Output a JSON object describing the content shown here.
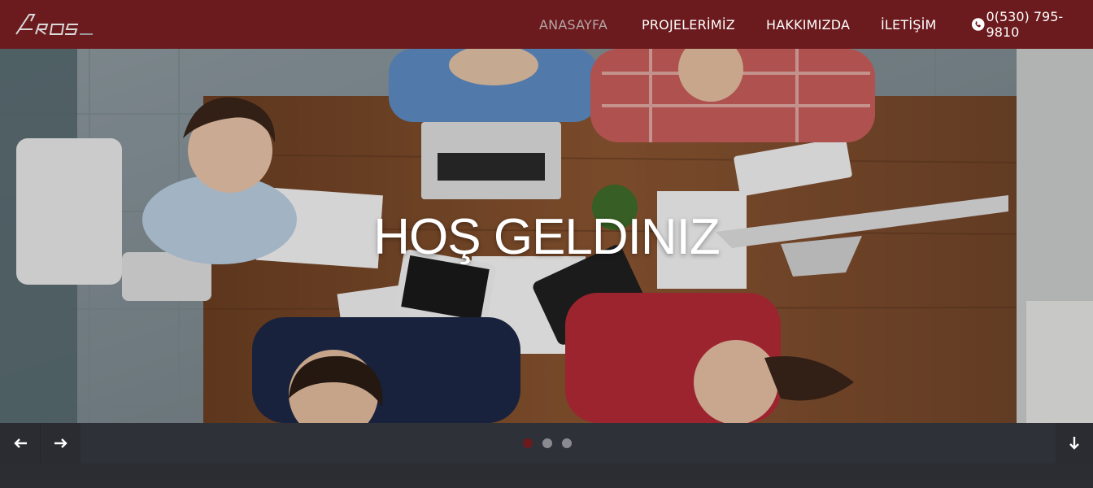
{
  "brand": {
    "logo_text": "Aros"
  },
  "nav": {
    "items": [
      {
        "label": "ANASAYFA",
        "active": true
      },
      {
        "label": "PROJELERİMİZ",
        "active": false
      },
      {
        "label": "HAKKIMIZDA",
        "active": false
      },
      {
        "label": "İLETİŞİM",
        "active": false
      }
    ],
    "phone": "0(530) 795-9810",
    "phone_icon": "phone-icon"
  },
  "hero": {
    "title": "HOŞ GELDINIZ",
    "image_description_icon": "team-meeting-photo"
  },
  "slider": {
    "prev_icon": "arrow-left-icon",
    "next_icon": "arrow-right-icon",
    "down_icon": "arrow-down-icon",
    "dots": [
      {
        "active": true
      },
      {
        "active": false
      },
      {
        "active": false
      }
    ]
  },
  "colors": {
    "header_bg": "#6b1a1d",
    "accent": "#6b1a1d",
    "bar_bg": "#2f3138",
    "page_bg": "#2b2d33",
    "nav_active": "#b5a6a6"
  }
}
